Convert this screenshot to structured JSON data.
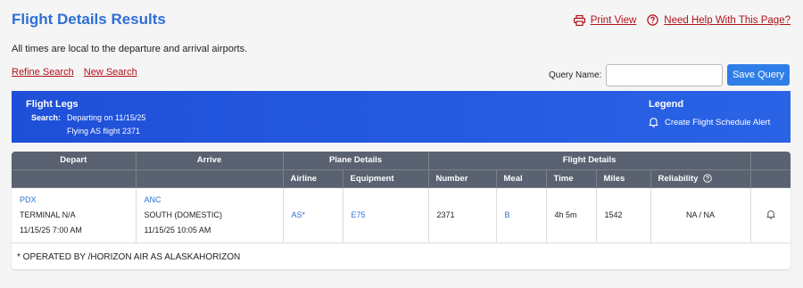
{
  "page": {
    "title": "Flight Details Results",
    "print_label": "Print View",
    "help_label": "Need Help With This Page?",
    "subtitle": "All times are local to the departure and arrival airports."
  },
  "links": {
    "refine": "Refine Search",
    "new": "New Search"
  },
  "query": {
    "label": "Query Name:",
    "value": "",
    "save_label": "Save Query"
  },
  "banner": {
    "title": "Flight Legs",
    "search_label": "Search:",
    "search_line1": "Departing on 11/15/25",
    "search_line2": "Flying AS flight 2371",
    "legend_title": "Legend",
    "legend_item": "Create Flight Schedule Alert"
  },
  "table": {
    "group_headers": {
      "depart": "Depart",
      "arrive": "Arrive",
      "plane": "Plane Details",
      "flight": "Flight Details"
    },
    "sub_headers": {
      "airline": "Airline",
      "equipment": "Equipment",
      "number": "Number",
      "meal": "Meal",
      "time": "Time",
      "miles": "Miles",
      "reliability": "Reliability"
    },
    "row": {
      "depart_code": "PDX",
      "depart_terminal": "TERMINAL N/A",
      "depart_time": "11/15/25 7:00 AM",
      "arrive_code": "ANC",
      "arrive_terminal": "SOUTH (DOMESTIC)",
      "arrive_time": "11/15/25 10:05 AM",
      "airline": "AS*",
      "equipment": "E75",
      "number": "2371",
      "meal": "B",
      "time": "4h 5m",
      "miles": "1542",
      "reliability": "NA / NA"
    },
    "footnote": "* OPERATED BY /HORIZON AIR AS ALASKAHORIZON"
  },
  "colors": {
    "accent": "#2f6fd6",
    "link_red": "#b0121b",
    "banner_blue": "#1e4fd8",
    "header_gray": "#5a6271"
  },
  "icons": [
    "printer-icon",
    "help-icon",
    "bell-icon",
    "info-icon",
    "bell-alert-icon"
  ]
}
